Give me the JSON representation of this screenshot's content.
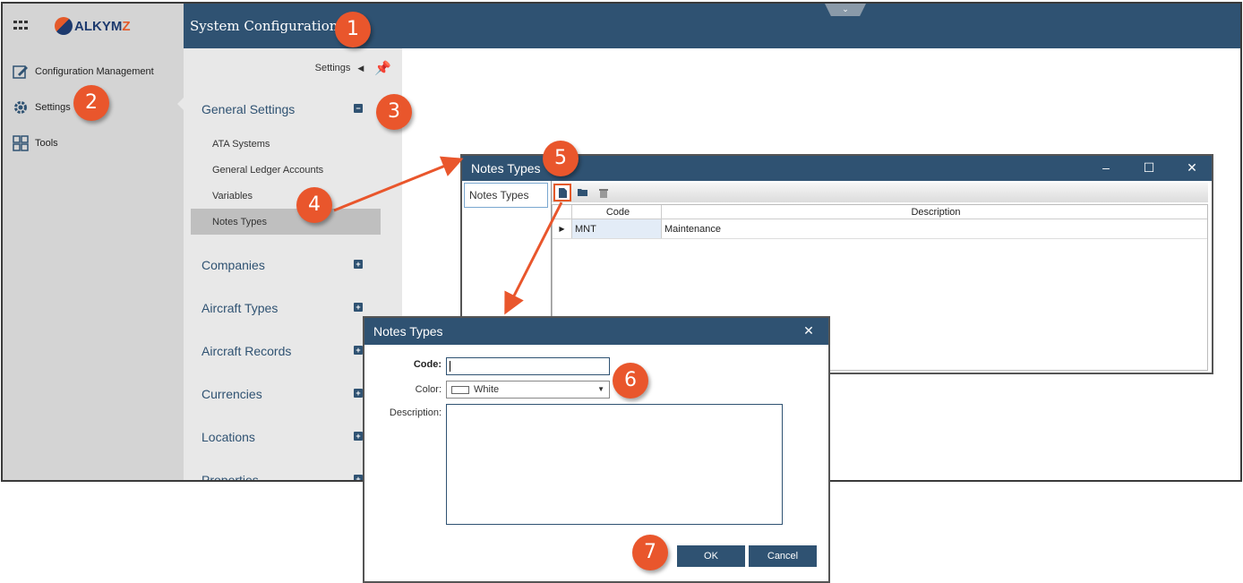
{
  "app": {
    "logo_text": "ALKYM",
    "logo_z": "Z",
    "window_title": "System Configuration",
    "left_nav": [
      {
        "label": "Configuration Management",
        "icon": "edit-icon"
      },
      {
        "label": "Settings",
        "icon": "gear-icon"
      },
      {
        "label": "Tools",
        "icon": "tools-icon"
      }
    ]
  },
  "settings_panel": {
    "header": "Settings",
    "groups": [
      {
        "label": "General Settings",
        "toggle": "−"
      },
      {
        "label": "Companies",
        "toggle": "+"
      },
      {
        "label": "Aircraft Types",
        "toggle": "+"
      },
      {
        "label": "Aircraft Records",
        "toggle": "+"
      },
      {
        "label": "Currencies",
        "toggle": "+"
      },
      {
        "label": "Locations",
        "toggle": "+"
      },
      {
        "label": "Properties",
        "toggle": "+"
      }
    ],
    "sub_items": [
      "ATA Systems",
      "General Ledger Accounts",
      "Variables",
      "Notes Types"
    ],
    "selected_sub_item": "Notes Types"
  },
  "notes_window": {
    "title": "Notes Types",
    "left_tab": "Notes Types",
    "columns": [
      "Code",
      "Description"
    ],
    "rows": [
      {
        "code": "MNT",
        "description": "Maintenance"
      }
    ]
  },
  "dialog": {
    "title": "Notes Types",
    "code_label": "Code:",
    "code_value": "",
    "color_label": "Color:",
    "color_value": "White",
    "description_label": "Description:",
    "ok_label": "OK",
    "cancel_label": "Cancel"
  },
  "callouts": [
    "1",
    "2",
    "3",
    "4",
    "5",
    "6",
    "7"
  ],
  "colors": {
    "header": "#2f5272",
    "accent": "#e9562c",
    "sidebar": "#d4d4d4",
    "panel": "#e8e8e8"
  }
}
